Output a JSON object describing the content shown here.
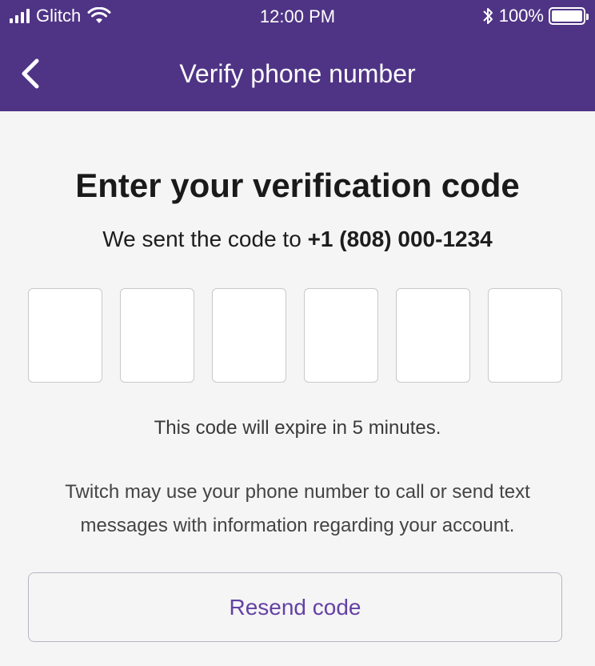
{
  "status_bar": {
    "carrier": "Glitch",
    "time": "12:00 PM",
    "battery_percent": "100%"
  },
  "nav": {
    "title": "Verify phone number",
    "back_icon": "chevron-left-icon"
  },
  "main": {
    "headline": "Enter your verification code",
    "sent_prefix": "We sent the code to ",
    "phone_number": "+1 (808) 000-1234",
    "code_digits": [
      "",
      "",
      "",
      "",
      "",
      ""
    ],
    "expire_text": "This code will expire in 5 minutes.",
    "notice_text": "Twitch may use your phone number to call or send text messages with information regarding your account.",
    "resend_label": "Resend code"
  },
  "colors": {
    "header_bg": "#4f3485",
    "accent": "#6441a4",
    "page_bg": "#f5f5f6"
  }
}
